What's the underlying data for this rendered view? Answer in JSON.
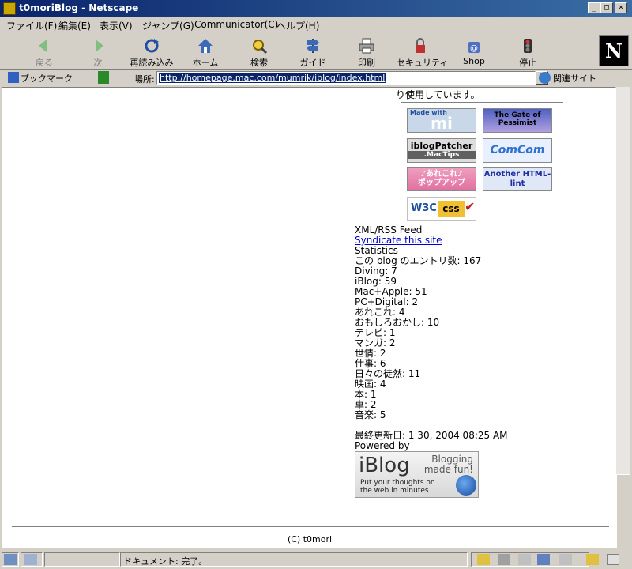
{
  "window": {
    "title": "t0moriBlog - Netscape"
  },
  "menu": [
    "ファイル(F)",
    "編集(E)",
    "表示(V)",
    "ジャンプ(G)",
    "Communicator(C)",
    "ヘルプ(H)"
  ],
  "toolbar": {
    "back": "戻る",
    "forward": "次",
    "reload": "再読み込み",
    "home": "ホーム",
    "search": "検索",
    "guide": "ガイド",
    "print": "印刷",
    "security": "セキュリティ",
    "shop": "Shop",
    "stop": "停止"
  },
  "location": {
    "bookmarks": "ブックマーク",
    "label": "場所:",
    "url": "http://homepage.mac.com/mumrik/iblog/index.html",
    "related": "関連サイト"
  },
  "page": {
    "note": "り使用しています。",
    "badges": {
      "madewithmi": "mi",
      "madewith_small": "Made with",
      "gate": "The Gate of Pessimist",
      "iblogpatcher": "iblogPatcher",
      "iblogpatcher_sub": ".MacTips",
      "comcom": "ComCom",
      "arekore": "♪あれこれ♪",
      "arekore_sub": "ポップアップ",
      "htmllint": "Another HTML-lint",
      "w3c": "W3C",
      "css": "css"
    },
    "feed_heading": "XML/RSS Feed",
    "feed_link": "Syndicate this site",
    "stats_heading": "Statistics",
    "stats": [
      "この blog のエントリ数: 167",
      "Diving: 7",
      "iBlog: 59",
      "Mac+Apple: 51",
      "PC+Digital: 2",
      "あれこれ: 4",
      "おもしろおかし: 10",
      "テレビ: 1",
      "マンガ: 2",
      "世情: 2",
      "仕事: 6",
      "日々の徒然: 11",
      "映画: 4",
      "本: 1",
      "車: 2",
      "音楽: 5"
    ],
    "last_updated": "最終更新日: 1 30, 2004 08:25 AM",
    "powered_by": "Powered by",
    "iblog_banner": {
      "logo": "iBlog",
      "tagline1": "Blogging",
      "tagline2": "made fun!",
      "small1": "Put your thoughts on",
      "small2": "the web in minutes"
    },
    "copyright": "(C) t0mori"
  },
  "status": {
    "text": "ドキュメント: 完了。"
  }
}
